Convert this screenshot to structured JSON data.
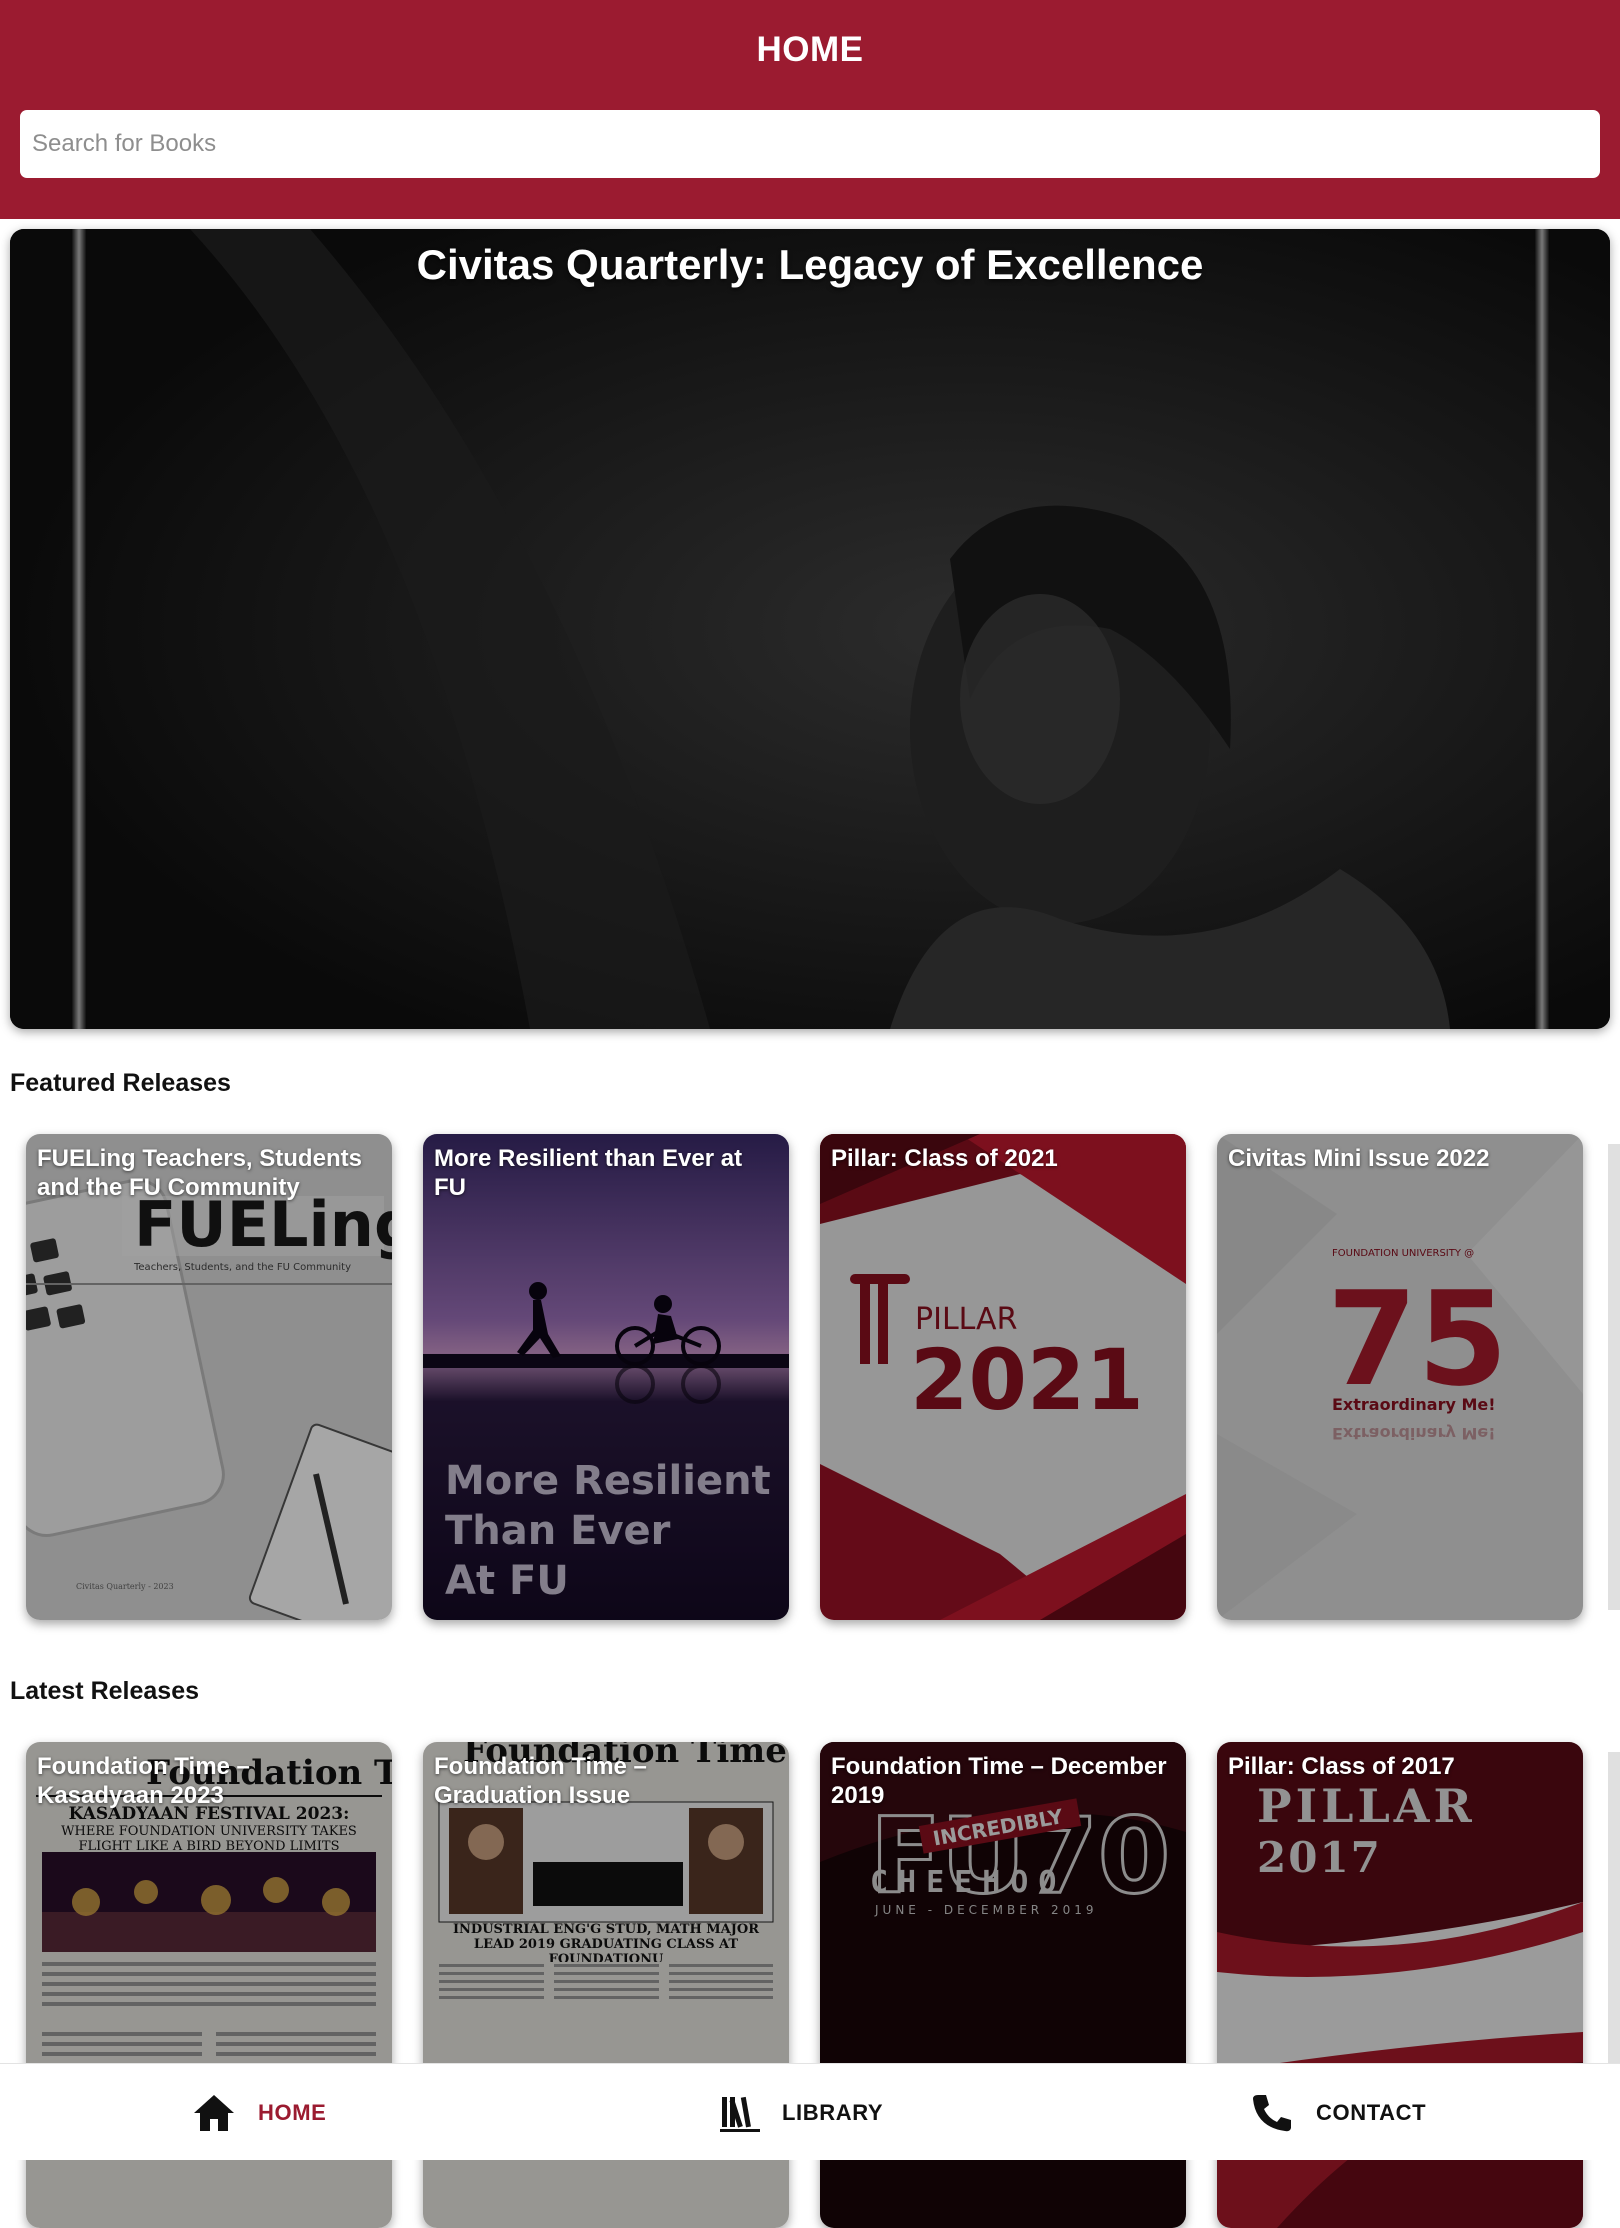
{
  "header": {
    "title": "HOME",
    "search_placeholder": "Search for Books"
  },
  "hero": {
    "title": "Civitas Quarterly: Legacy of Excellence"
  },
  "featured": {
    "heading": "Featured Releases",
    "items": [
      {
        "title": "FUELing Teachers, Students and the FU Community",
        "cover_text": "FUELing",
        "cover_subtext": "Teachers, Students, and the FU Community",
        "cover_footer": "Civitas Quarterly - 2023"
      },
      {
        "title": "More Resilient than Ever at FU",
        "cover_lines": [
          "More Resilient",
          "Than Ever",
          "At FU"
        ]
      },
      {
        "title": "Pillar: Class of 2021",
        "cover_word": "PILLAR",
        "cover_year": "2021"
      },
      {
        "title": "Civitas Mini Issue 2022",
        "cover_top": "FOUNDATION UNIVERSITY @",
        "cover_number": "75",
        "cover_tagline": "Extraordinary Me!"
      }
    ]
  },
  "latest": {
    "heading": "Latest Releases",
    "items": [
      {
        "title": "Foundation Time – Kasadyaan 2023",
        "cover_masthead": "Foundation Time",
        "cover_headline": "KASADYAAN FESTIVAL 2023:",
        "cover_sub": "WHERE FOUNDATION UNIVERSITY TAKES FLIGHT LIKE A BIRD BEYOND LIMITS"
      },
      {
        "title": "Foundation Time – Graduation Issue",
        "cover_masthead": "Foundation Time",
        "cover_headline": "INDUSTRIAL ENG'G STUD, MATH MAJOR LEAD 2019 GRADUATING CLASS AT FOUNDATIONU"
      },
      {
        "title": "Foundation Time – December 2019",
        "cover_big": "FU70",
        "cover_ribbon": "INCREDIBLY",
        "cover_word": "CHEEHOO",
        "cover_date": "JUNE - DECEMBER 2019"
      },
      {
        "title": "Pillar: Class of 2017",
        "cover_word": "PILLAR",
        "cover_year": "2017"
      }
    ]
  },
  "bottom_nav": {
    "items": [
      {
        "label": "HOME",
        "icon": "home-icon",
        "active": true
      },
      {
        "label": "LIBRARY",
        "icon": "library-icon",
        "active": false
      },
      {
        "label": "CONTACT",
        "icon": "phone-icon",
        "active": false
      }
    ]
  },
  "colors": {
    "brand": "#9b1b30",
    "active_nav": "#9b1b30"
  }
}
